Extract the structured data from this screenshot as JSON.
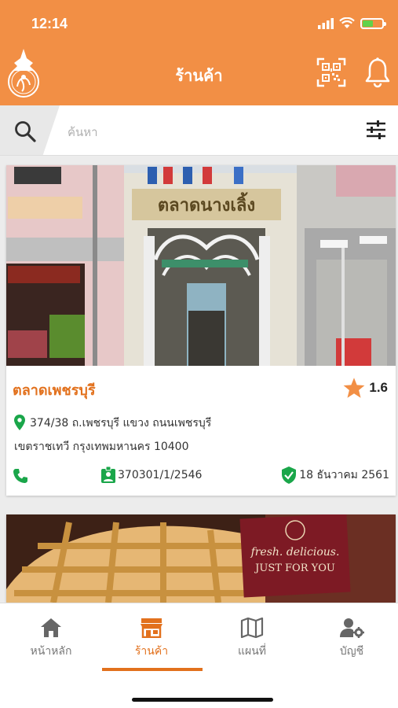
{
  "status_bar": {
    "time": "12:14"
  },
  "header": {
    "title": "ร้านค้า"
  },
  "search": {
    "placeholder": "ค้นหา"
  },
  "shops": [
    {
      "name": "ตลาดเพชรบุรี",
      "rating": "1.6",
      "address_line1": "374/38 ถ.เพชรบุรี แขวง ถนนเพชรบุรี",
      "address_line2": "เขตราชเทวี กรุงเทพมหานคร 10400",
      "license_no": "370301/1/2546",
      "verified_date": "18 ธันวาคม 2561",
      "sign_text": "ตลาดนางเลิ้ง"
    },
    {
      "sign_line1": "fresh. delicious.",
      "sign_line2": "JUST FOR YOU"
    }
  ],
  "tabs": [
    {
      "label": "หน้าหลัก",
      "icon": "home-icon"
    },
    {
      "label": "ร้านค้า",
      "icon": "shop-icon"
    },
    {
      "label": "แผนที่",
      "icon": "map-icon"
    },
    {
      "label": "บัญชี",
      "icon": "account-settings-icon"
    }
  ],
  "colors": {
    "accent": "#f28f45",
    "active": "#e2711d",
    "green": "#1aa64a",
    "star": "#f28f45"
  }
}
